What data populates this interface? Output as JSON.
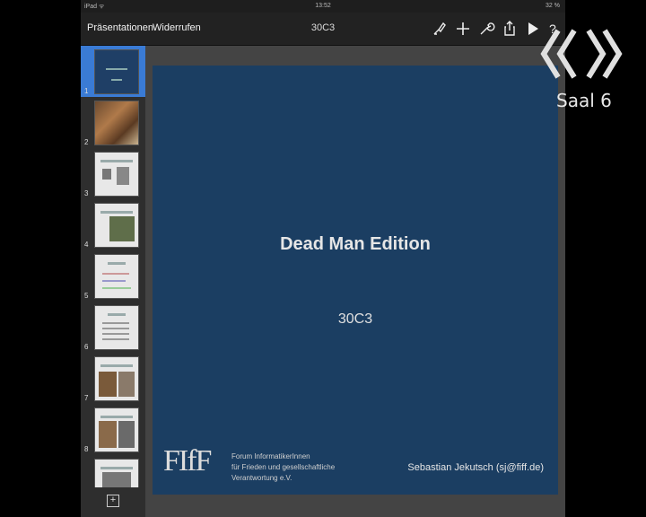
{
  "status_bar": {
    "carrier": "iPad ᯤ",
    "time": "13:52",
    "battery": "32 %"
  },
  "toolbar": {
    "presentations_label": "Präsentationen",
    "undo_label": "Widerrufen",
    "title": "30C3"
  },
  "sidebar": {
    "slides": [
      {
        "number": "1"
      },
      {
        "number": "2"
      },
      {
        "number": "3"
      },
      {
        "number": "4"
      },
      {
        "number": "5"
      },
      {
        "number": "6"
      },
      {
        "number": "7"
      },
      {
        "number": "8"
      }
    ],
    "add_label": "+"
  },
  "slide": {
    "title": "Dead Man Edition",
    "subtitle": "30C3",
    "logo_text": "FIfF",
    "org_line1": "Forum InformatikerInnen",
    "org_line2": "für Frieden und gesellschaftliche",
    "org_line3": "Verantwortung e.V.",
    "author": "Sebastian Jekutsch (sj@fiff.de)"
  },
  "overlay": {
    "label": "Saal 6"
  },
  "colors": {
    "slide_bg": "#1b3e62",
    "selection": "#3a7bd5"
  }
}
